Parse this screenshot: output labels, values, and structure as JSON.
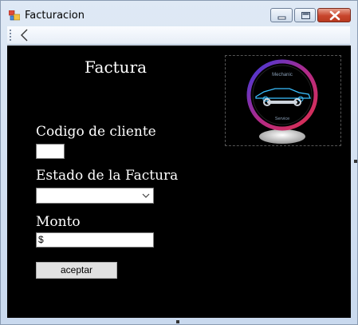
{
  "window": {
    "title": "Facturacion",
    "icon": "winforms-app-icon"
  },
  "toolbar": {
    "back_icon": "chevron-left-icon"
  },
  "form": {
    "heading": "Factura",
    "codigo_label": "Codigo de cliente",
    "codigo_value": "",
    "estado_label": "Estado de la Factura",
    "estado_value": "",
    "monto_label": "Monto",
    "monto_value": "$",
    "submit_label": "aceptar"
  },
  "logo": {
    "top_text": "Mechanic",
    "bottom_text": "Service"
  },
  "colors": {
    "client_bg": "#000000",
    "text": "#ffffff",
    "close_button": "#c8452c"
  }
}
